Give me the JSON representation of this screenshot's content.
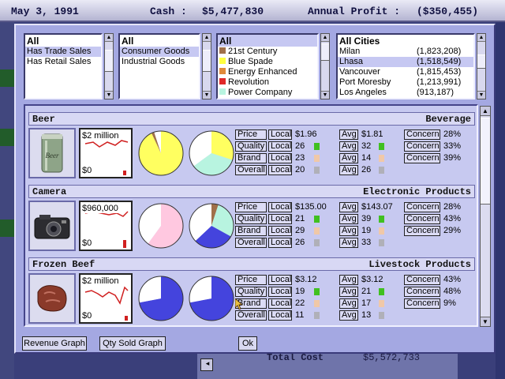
{
  "status": {
    "date": "May 3, 1991",
    "cash_label": "Cash :",
    "cash_value": "$5,477,830",
    "profit_label": "Annual Profit :",
    "profit_value": "($350,455)"
  },
  "background": {
    "total_cost_label": "Total Cost",
    "total_cost_value": "$5,572,733"
  },
  "filters": {
    "trade": {
      "header": "All",
      "items": [
        "Has Trade Sales",
        "Has Retail Sales"
      ],
      "selected": 0
    },
    "category": {
      "header": "All",
      "items": [
        "Consumer Goods",
        "Industrial Goods"
      ],
      "selected": 0
    },
    "company": {
      "header": "All",
      "items": [
        {
          "label": "21st Century",
          "color": "#a0704a"
        },
        {
          "label": "Blue Spade",
          "color": "#ffff40"
        },
        {
          "label": "Energy Enhanced",
          "color": "#e08a3a"
        },
        {
          "label": "Revolution",
          "color": "#e02828"
        },
        {
          "label": "Power Company",
          "color": "#b8f4e0"
        }
      ]
    },
    "cities": {
      "header": "All Cities",
      "items": [
        {
          "name": "Milan",
          "pop": "(1,823,208)"
        },
        {
          "name": "Lhasa",
          "pop": "(1,518,549)"
        },
        {
          "name": "Vancouver",
          "pop": "(1,815,453)"
        },
        {
          "name": "Port Moresby",
          "pop": "(1,213,991)"
        },
        {
          "name": "Los Angeles",
          "pop": "(913,187)"
        }
      ],
      "selected": 1
    }
  },
  "row_labels": [
    "Price",
    "Quality",
    "Brand",
    "Overall"
  ],
  "local_label": "Local",
  "avg_label": "Avg",
  "concern_label": "Concern",
  "products": [
    {
      "name": "Beer",
      "category": "Beverage",
      "graph_top": "$2 million",
      "graph_bottom": "$0",
      "local": [
        "$1.96",
        "26",
        "23",
        "20"
      ],
      "avg": [
        "$1.81",
        "32",
        "14",
        "26"
      ],
      "concern": [
        "28%",
        "33%",
        "39%"
      ],
      "local_bar_colors": [
        "",
        "#40c020",
        "#f0c8a8",
        "#b0b0b8"
      ],
      "avg_bar_colors": [
        "",
        "#40c020",
        "#f0c8a8",
        "#b0b0b8"
      ],
      "pie1": [
        {
          "pct": 93,
          "color": "#ffff60"
        },
        {
          "pct": 2,
          "color": "#a0704a"
        },
        {
          "pct": 5,
          "color": "#ffffff"
        }
      ],
      "pie2": [
        {
          "pct": 30,
          "color": "#ffff60"
        },
        {
          "pct": 35,
          "color": "#b8f4e0"
        },
        {
          "pct": 35,
          "color": "#ffffff"
        }
      ]
    },
    {
      "name": "Camera",
      "category": "Electronic Products",
      "graph_top": "$960,000",
      "graph_bottom": "$0",
      "local": [
        "$135.00",
        "21",
        "29",
        "26"
      ],
      "avg": [
        "$143.07",
        "39",
        "19",
        "33"
      ],
      "concern": [
        "28%",
        "43%",
        "29%"
      ],
      "local_bar_colors": [
        "",
        "#40c020",
        "#f0c8a8",
        "#b0b0b8"
      ],
      "avg_bar_colors": [
        "",
        "#40c020",
        "#f0c8a8",
        "#b0b0b8"
      ],
      "pie1": [
        {
          "pct": 60,
          "color": "#ffc8e0"
        },
        {
          "pct": 40,
          "color": "#ffffff"
        }
      ],
      "pie2": [
        {
          "pct": 5,
          "color": "#a0704a"
        },
        {
          "pct": 28,
          "color": "#b8f4e0"
        },
        {
          "pct": 30,
          "color": "#4444dd"
        },
        {
          "pct": 37,
          "color": "#ffffff"
        }
      ]
    },
    {
      "name": "Frozen Beef",
      "category": "Livestock Products",
      "graph_top": "$2 million",
      "graph_bottom": "$0",
      "local": [
        "$3.12",
        "19",
        "22",
        "11"
      ],
      "avg": [
        "$3.12",
        "21",
        "17",
        "13"
      ],
      "concern": [
        "43%",
        "48%",
        "9%"
      ],
      "local_bar_colors": [
        "",
        "#40c020",
        "#f0c8a8",
        "#b0b0b8"
      ],
      "avg_bar_colors": [
        "",
        "#40c020",
        "#f0c8a8",
        "#b0b0b8"
      ],
      "pie1": [
        {
          "pct": 72,
          "color": "#4444dd"
        },
        {
          "pct": 28,
          "color": "#ffffff"
        }
      ],
      "pie2": [
        {
          "pct": 72,
          "color": "#4444dd"
        },
        {
          "pct": 28,
          "color": "#ffffff"
        }
      ]
    }
  ],
  "buttons": {
    "revenue_graph": "Revenue Graph",
    "qty_sold_graph": "Qty Sold Graph",
    "ok": "Ok"
  }
}
